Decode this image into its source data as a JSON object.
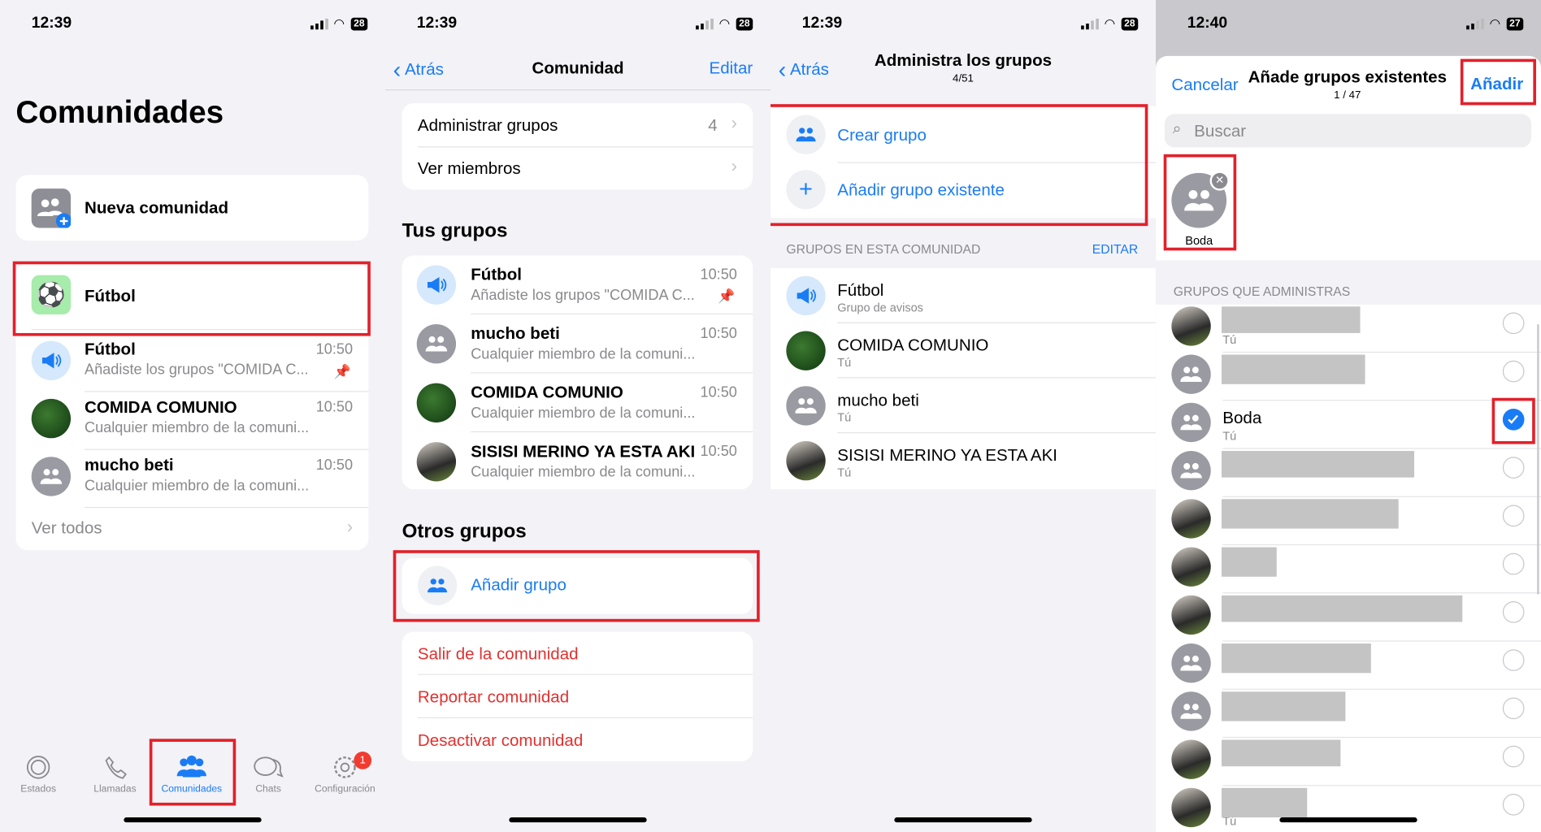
{
  "colors": {
    "accent": "#1a7cf5",
    "destructive": "#e0312f",
    "highlight": "#e3202a",
    "background": "#f2f2f7"
  },
  "panel1": {
    "time": "12:39",
    "battery": "28",
    "title": "Comunidades",
    "new_community": "Nueva comunidad",
    "community_name": "Fútbol",
    "chats": [
      {
        "name": "Fútbol",
        "preview": "Añadiste los grupos \"COMIDA C...",
        "time": "10:50",
        "icon": "megaphone-icon",
        "pinned": true
      },
      {
        "name": "COMIDA COMUNIO",
        "preview": "Cualquier miembro de la comuni...",
        "time": "10:50",
        "icon": "group-photo"
      },
      {
        "name": "mucho beti",
        "preview": "Cualquier miembro de la comuni...",
        "time": "10:50",
        "icon": "people-icon"
      }
    ],
    "see_all": "Ver todos",
    "tabs": [
      {
        "label": "Estados",
        "icon": "status-icon"
      },
      {
        "label": "Llamadas",
        "icon": "phone-icon"
      },
      {
        "label": "Comunidades",
        "icon": "communities-icon",
        "active": true
      },
      {
        "label": "Chats",
        "icon": "chats-icon"
      },
      {
        "label": "Configuración",
        "icon": "gear-icon",
        "badge": "1"
      }
    ]
  },
  "panel2": {
    "time": "12:39",
    "battery": "28",
    "back": "Atrás",
    "title": "Comunidad",
    "edit": "Editar",
    "manage_groups": "Administrar grupos",
    "manage_count": "4",
    "see_members": "Ver miembros",
    "your_groups": "Tus grupos",
    "groups": [
      {
        "name": "Fútbol",
        "preview": "Añadiste los grupos \"COMIDA C...",
        "time": "10:50",
        "icon": "megaphone-icon",
        "pinned": true
      },
      {
        "name": "mucho beti",
        "preview": "Cualquier miembro de la comuni...",
        "time": "10:50",
        "icon": "people-icon"
      },
      {
        "name": "COMIDA COMUNIO",
        "preview": "Cualquier miembro de la comuni...",
        "time": "10:50",
        "icon": "group-photo"
      },
      {
        "name": "SISISI MERINO YA ESTA AKI",
        "preview": "Cualquier miembro de la comuni...",
        "time": "10:50",
        "icon": "person-photo"
      }
    ],
    "other_groups": "Otros grupos",
    "add_group": "Añadir grupo",
    "actions": [
      "Salir de la comunidad",
      "Reportar comunidad",
      "Desactivar comunidad"
    ]
  },
  "panel3": {
    "time": "12:39",
    "battery": "28",
    "back": "Atrás",
    "title": "Administra los grupos",
    "subtitle": "4/51",
    "create_group": "Crear grupo",
    "add_existing": "Añadir grupo existente",
    "section": "GRUPOS EN ESTA COMUNIDAD",
    "section_edit": "EDITAR",
    "groups": [
      {
        "name": "Fútbol",
        "sub": "Grupo de avisos",
        "icon": "megaphone-icon"
      },
      {
        "name": "COMIDA COMUNIO",
        "sub": "Tú",
        "icon": "group-photo"
      },
      {
        "name": "mucho beti",
        "sub": "Tú",
        "icon": "people-icon"
      },
      {
        "name": "SISISI MERINO YA ESTA AKI",
        "sub": "Tú",
        "icon": "person-photo"
      }
    ]
  },
  "panel4": {
    "time": "12:40",
    "battery": "27",
    "cancel": "Cancelar",
    "title": "Añade grupos existentes",
    "subtitle": "1 / 47",
    "add": "Añadir",
    "search_placeholder": "Buscar",
    "selected": [
      {
        "name": "Boda"
      }
    ],
    "section": "GRUPOS QUE ADMINISTRAS",
    "groups": [
      {
        "name": "",
        "sub": "Tú",
        "redacted": true,
        "selected": false,
        "icon": "photo"
      },
      {
        "name": "",
        "sub": "",
        "redacted": true,
        "selected": false,
        "icon": "people-icon"
      },
      {
        "name": "Boda",
        "sub": "Tú",
        "redacted": false,
        "selected": true,
        "icon": "people-icon"
      },
      {
        "name": "",
        "sub": "",
        "redacted": true,
        "selected": false,
        "icon": "people-icon"
      },
      {
        "name": "",
        "sub": "",
        "redacted": true,
        "selected": false,
        "icon": "photo"
      },
      {
        "name": "",
        "sub": "",
        "redacted": true,
        "selected": false,
        "icon": "photo"
      },
      {
        "name": "",
        "sub": "",
        "redacted": true,
        "selected": false,
        "icon": "photo"
      },
      {
        "name": "",
        "sub": "",
        "redacted": true,
        "selected": false,
        "icon": "people-icon"
      },
      {
        "name": "",
        "sub": "",
        "redacted": true,
        "selected": false,
        "icon": "people-icon"
      },
      {
        "name": "",
        "sub": "",
        "redacted": true,
        "selected": false,
        "icon": "photo"
      },
      {
        "name": "",
        "sub": "Tú",
        "redacted": true,
        "selected": false,
        "icon": "photo"
      }
    ]
  }
}
